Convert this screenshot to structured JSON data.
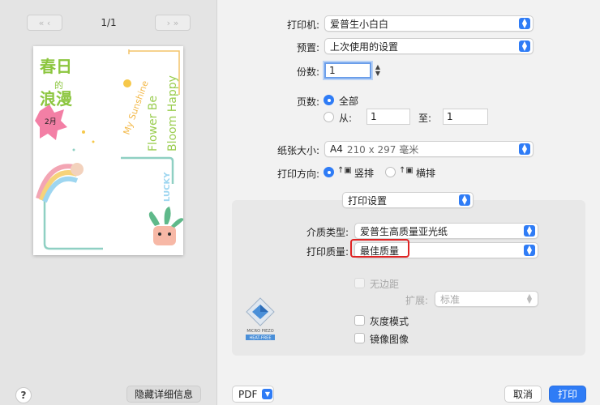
{
  "preview": {
    "prev_glyph": "«  ‹",
    "next_glyph": "›  »",
    "page_indicator": "1/1",
    "artwork": {
      "title_line1": "春日",
      "title_line2": "的",
      "title_line3": "浪漫",
      "badge": "2月",
      "vertical_text_1": "Flower Be",
      "vertical_text_2": "Bloom Happy",
      "vertical_text_3": "My Sunshine",
      "vertical_text_4": "LUCKY"
    }
  },
  "bottom_left": {
    "help_label": "?",
    "hide_details_label": "隐藏详细信息"
  },
  "form": {
    "printer_label": "打印机:",
    "printer_value": "爱普生小白白",
    "preset_label": "预置:",
    "preset_value": "上次使用的设置",
    "copies_label": "份数:",
    "copies_value": "1",
    "pages_label": "页数:",
    "pages_all": "全部",
    "pages_from": "从:",
    "pages_from_value": "1",
    "pages_to": "至:",
    "pages_to_value": "1",
    "paper_size_label": "纸张大小:",
    "paper_size_value": "A4",
    "paper_size_dims": "210 x 297 毫米",
    "orientation_label": "打印方向:",
    "orientation_portrait": "竖排",
    "orientation_landscape": "横排",
    "section_value": "打印设置"
  },
  "settings": {
    "media_label": "介质类型:",
    "media_value": "爱普生高质量亚光纸",
    "quality_label": "打印质量:",
    "quality_value": "最佳质量",
    "borderless_label": "无边距",
    "expand_label": "扩展:",
    "expand_value": "标准",
    "grayscale_label": "灰度模式",
    "mirror_label": "镜像图像",
    "logo_line1": "MICRO PIEZO",
    "logo_line2": "HEAT-FREE"
  },
  "footer": {
    "pdf_label": "PDF",
    "cancel_label": "取消",
    "print_label": "打印"
  },
  "colors": {
    "accent": "#2f7cf6",
    "highlight": "#e02424"
  }
}
